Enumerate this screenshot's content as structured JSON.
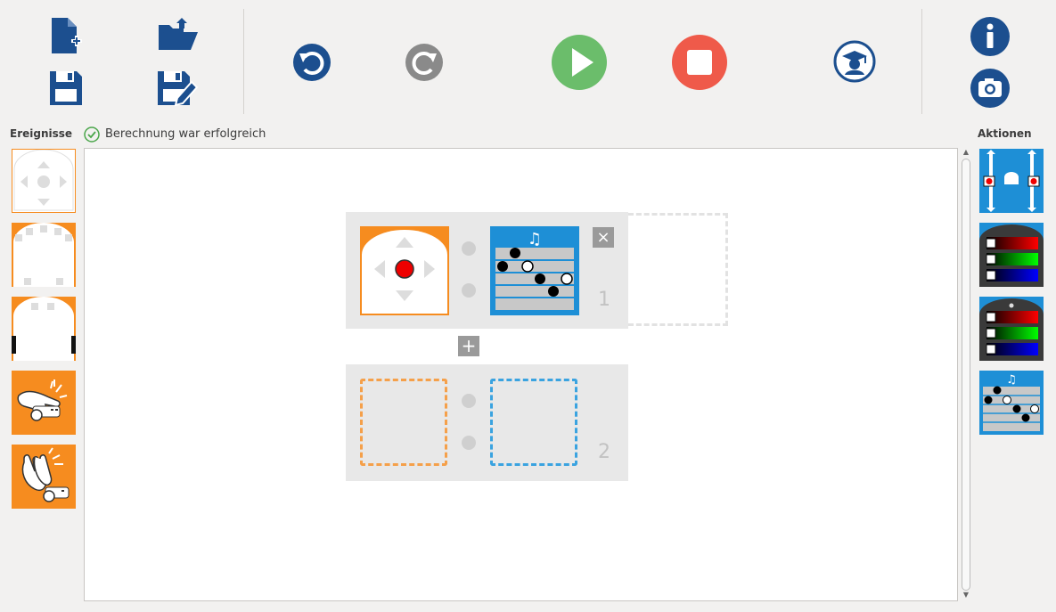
{
  "toolbar": {
    "new_file": "new-file-icon",
    "open_file": "open-folder-icon",
    "save": "save-icon",
    "save_as": "save-as-icon",
    "undo": "undo-icon",
    "redo": "redo-icon",
    "run": "play-icon",
    "stop": "stop-icon",
    "advanced": "graduation-cap-icon",
    "info": "info-icon",
    "screenshot": "camera-icon"
  },
  "colors": {
    "accent_blue": "#1c4f8f",
    "run_green": "#6bbd6b",
    "stop_red": "#ef5a4a",
    "redo_gray": "#8a8a8a",
    "event_orange": "#f68c1f",
    "action_blue": "#1e8fd6"
  },
  "left_panel": {
    "title": "Ereignisse",
    "tiles": [
      "buttons-event",
      "front-prox-event",
      "ground-prox-event",
      "tap-event",
      "clap-event"
    ]
  },
  "status": {
    "text": "Berechnung war erfolgreich",
    "icon": "check-circle-icon"
  },
  "right_panel": {
    "title": "Aktionen",
    "tiles": [
      "motors-action",
      "top-color-action",
      "bottom-color-action",
      "music-action"
    ]
  },
  "program": {
    "rows": [
      {
        "number": "1",
        "event": "buttons-event",
        "action": "music-action",
        "remove_label": "×"
      },
      {
        "number": "2",
        "event": "",
        "action": ""
      }
    ],
    "add_label": "+"
  }
}
